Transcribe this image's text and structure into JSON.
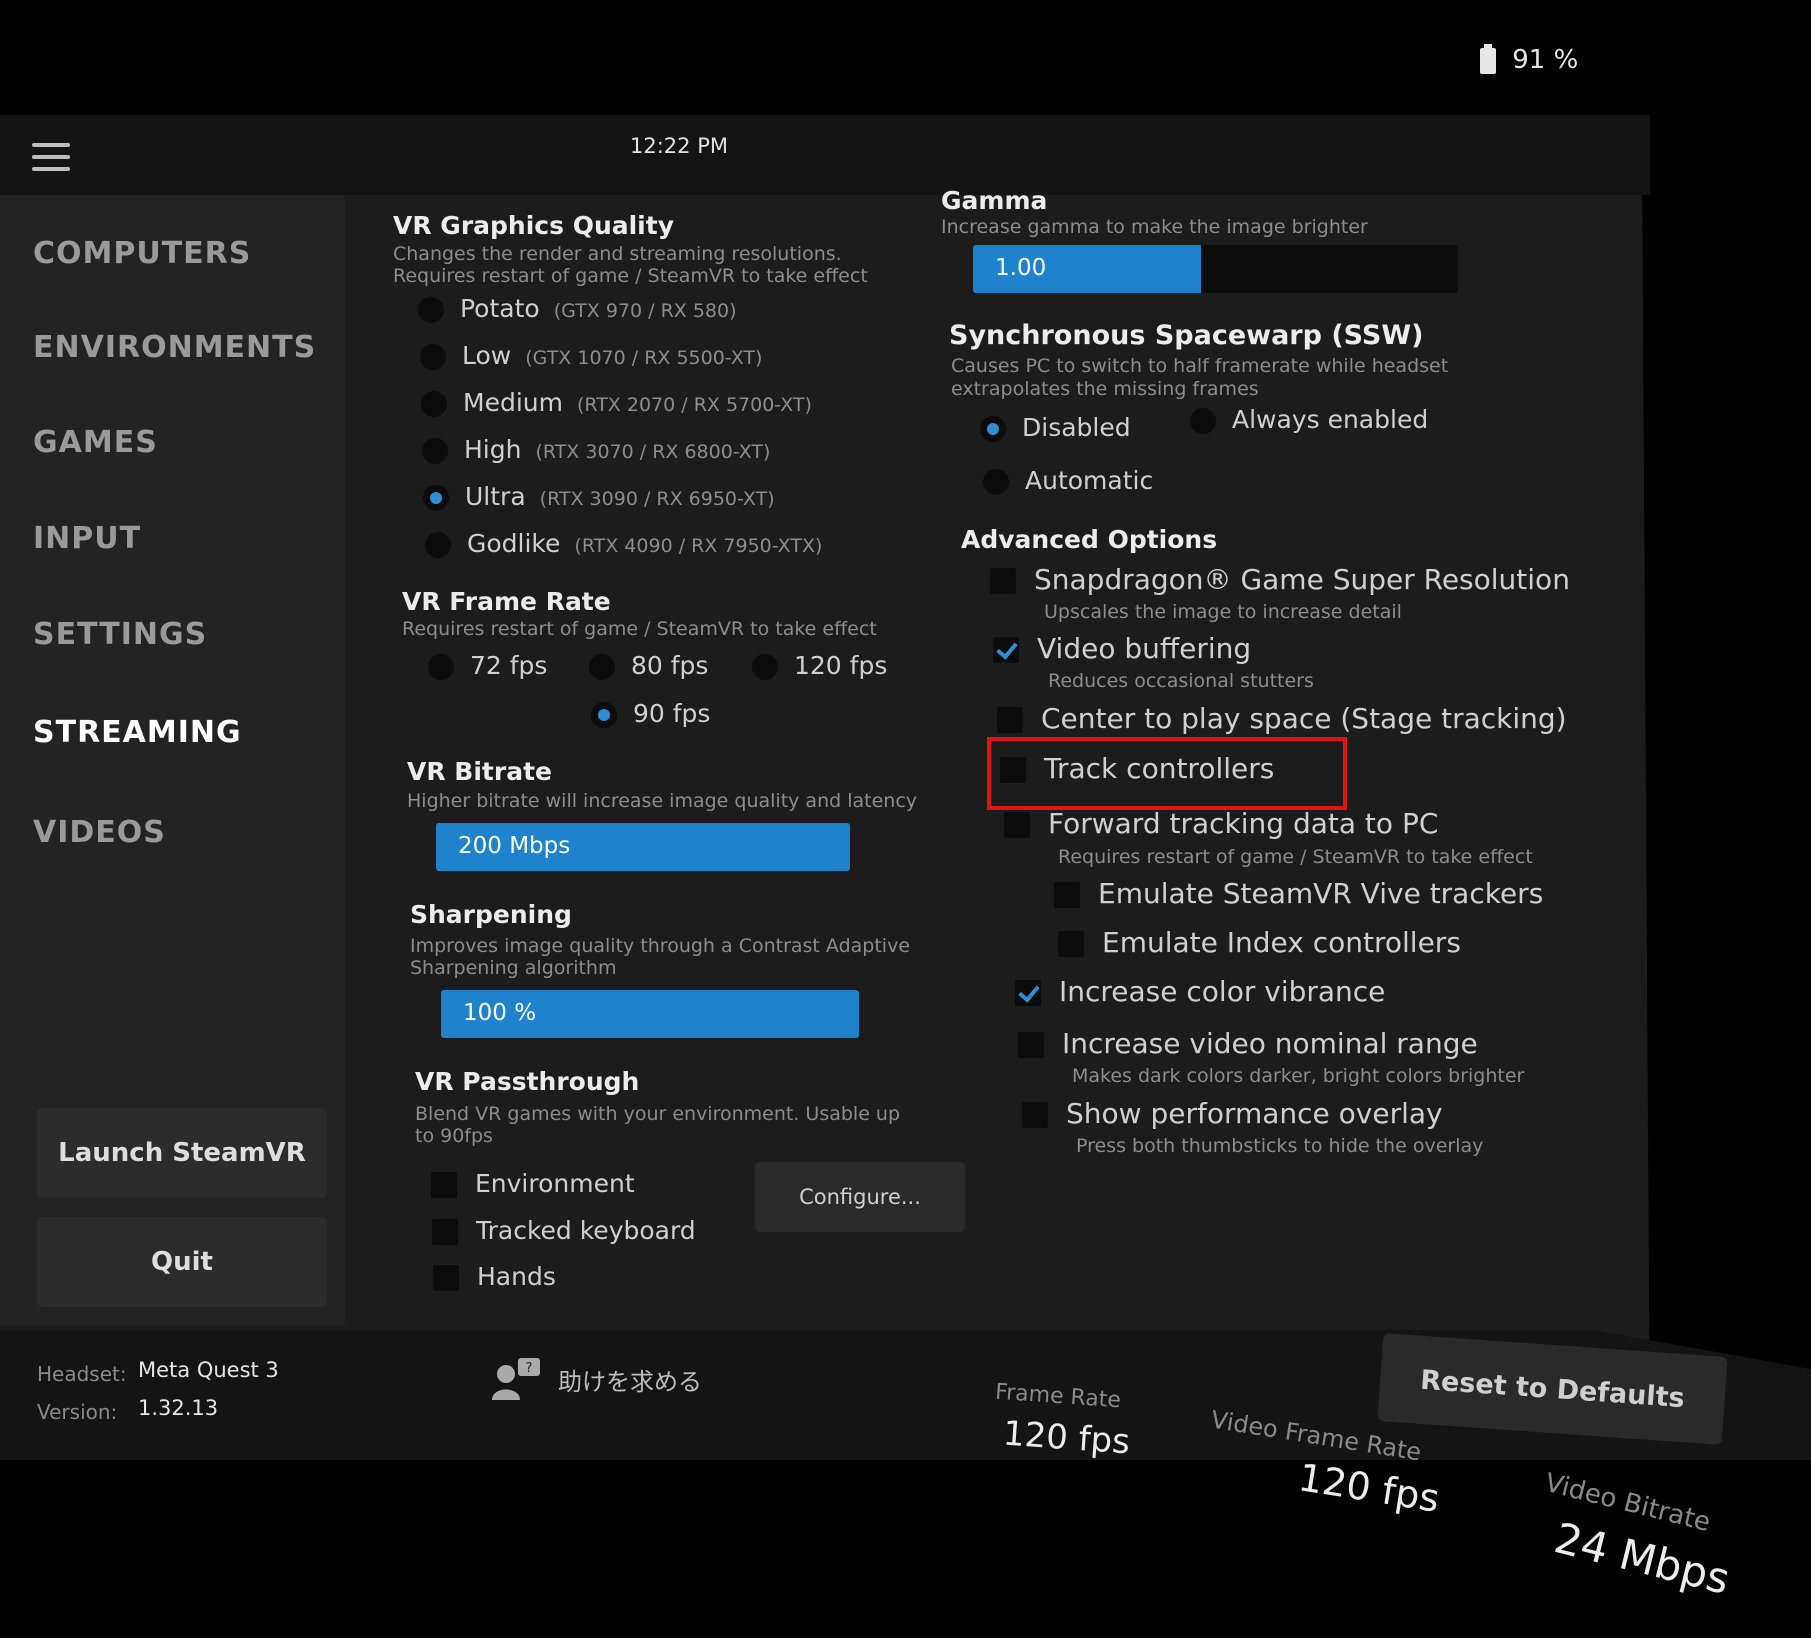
{
  "status": {
    "battery": "91 %",
    "time": "12:22 PM"
  },
  "sidebar": {
    "items": [
      {
        "label": "COMPUTERS"
      },
      {
        "label": "ENVIRONMENTS"
      },
      {
        "label": "GAMES"
      },
      {
        "label": "INPUT"
      },
      {
        "label": "SETTINGS"
      },
      {
        "label": "STREAMING",
        "active": true
      },
      {
        "label": "VIDEOS"
      }
    ],
    "launch_label": "Launch SteamVR",
    "quit_label": "Quit"
  },
  "graphics_quality": {
    "title": "VR Graphics Quality",
    "desc1": "Changes the render and streaming resolutions.",
    "desc2": "Requires restart of game / SteamVR to take effect",
    "options": [
      {
        "label": "Potato",
        "hint": "(GTX 970 / RX 580)",
        "selected": false
      },
      {
        "label": "Low",
        "hint": "(GTX 1070 / RX 5500-XT)",
        "selected": false
      },
      {
        "label": "Medium",
        "hint": "(RTX 2070 / RX 5700-XT)",
        "selected": false
      },
      {
        "label": "High",
        "hint": "(RTX 3070 / RX 6800-XT)",
        "selected": false
      },
      {
        "label": "Ultra",
        "hint": "(RTX 3090 / RX 6950-XT)",
        "selected": true
      },
      {
        "label": "Godlike",
        "hint": "(RTX 4090 / RX 7950-XTX)",
        "selected": false
      }
    ]
  },
  "frame_rate": {
    "title": "VR Frame Rate",
    "desc": "Requires restart of game / SteamVR to take effect",
    "options": [
      {
        "label": "72 fps",
        "selected": false
      },
      {
        "label": "80 fps",
        "selected": false
      },
      {
        "label": "120 fps",
        "selected": false
      },
      {
        "label": "90 fps",
        "selected": true
      }
    ]
  },
  "bitrate": {
    "title": "VR Bitrate",
    "desc": "Higher bitrate will increase image quality and latency",
    "value": "200 Mbps",
    "fill_fraction": 1.0
  },
  "sharpening": {
    "title": "Sharpening",
    "desc1": "Improves image quality through a Contrast Adaptive",
    "desc2": "Sharpening algorithm",
    "value": "100 %",
    "fill_fraction": 1.0
  },
  "passthrough": {
    "title": "VR Passthrough",
    "desc1": "Blend VR games with your environment. Usable up",
    "desc2": "to 90fps",
    "options": [
      {
        "label": "Environment",
        "checked": false
      },
      {
        "label": "Tracked keyboard",
        "checked": false
      },
      {
        "label": "Hands",
        "checked": false
      }
    ],
    "configure_label": "Configure..."
  },
  "gamma": {
    "title": "Gamma",
    "desc": "Increase gamma to make the image brighter",
    "value": "1.00",
    "fill_fraction": 0.47
  },
  "ssw": {
    "title": "Synchronous Spacewarp (SSW)",
    "desc1": "Causes PC to switch to half framerate while headset",
    "desc2": "extrapolates the missing frames",
    "options": [
      {
        "label": "Disabled",
        "selected": true
      },
      {
        "label": "Always enabled",
        "selected": false
      },
      {
        "label": "Automatic",
        "selected": false
      }
    ]
  },
  "advanced": {
    "title": "Advanced Options",
    "options": [
      {
        "label": "Snapdragon® Game Super Resolution",
        "sub": "Upscales the image to increase detail",
        "checked": false
      },
      {
        "label": "Video buffering",
        "sub": "Reduces occasional stutters",
        "checked": true
      },
      {
        "label": "Center to play space (Stage tracking)",
        "sub": "",
        "checked": false
      },
      {
        "label": "Track controllers",
        "sub": "",
        "checked": false
      },
      {
        "label": "Forward tracking data to PC",
        "sub": "Requires restart of game / SteamVR to take effect",
        "checked": false
      },
      {
        "label": "Emulate SteamVR Vive trackers",
        "sub": "",
        "checked": false
      },
      {
        "label": "Emulate Index controllers",
        "sub": "",
        "checked": false
      },
      {
        "label": "Increase color vibrance",
        "sub": "",
        "checked": true
      },
      {
        "label": "Increase video nominal range",
        "sub": "Makes dark colors darker, bright colors brighter",
        "checked": false
      },
      {
        "label": "Show performance overlay",
        "sub": "Press both thumbsticks to hide the overlay",
        "checked": false
      }
    ]
  },
  "footer": {
    "headset_label": "Headset:",
    "headset_value": "Meta Quest 3",
    "version_label": "Version:",
    "version_value": "1.32.13",
    "help_label": "助けを求める",
    "reset_label": "Reset to Defaults",
    "stats": [
      {
        "label": "Frame Rate",
        "value": "120 fps"
      },
      {
        "label": "Video Frame Rate",
        "value": "120 fps"
      },
      {
        "label": "Video Bitrate",
        "value": "24 Mbps"
      }
    ]
  },
  "colors": {
    "accent": "#2d8fd6",
    "highlight": "#e0131b"
  }
}
